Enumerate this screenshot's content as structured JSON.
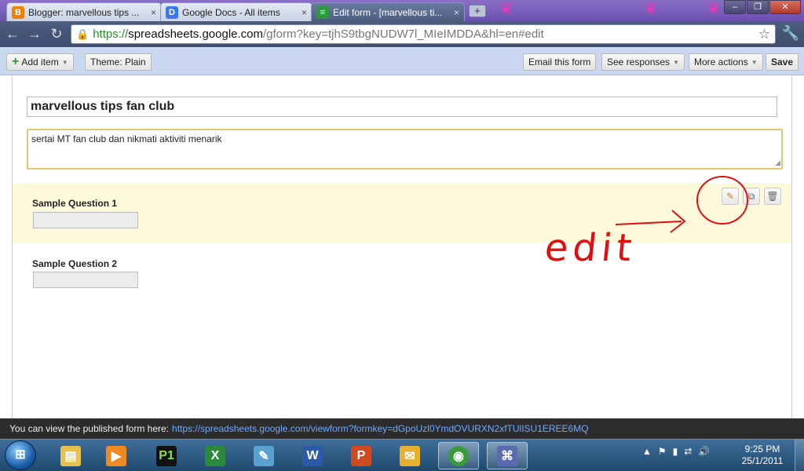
{
  "browser": {
    "tabs": [
      {
        "label": "Blogger: marvellous tips ...",
        "icon": "blogger-icon",
        "icon_char": "B",
        "icon_color": "#f57d00"
      },
      {
        "label": "Google Docs - All items",
        "icon": "google-docs-icon",
        "icon_char": "D",
        "icon_color": "#3b78e7"
      },
      {
        "label": "Edit form - [marvellous ti...",
        "icon": "form-icon",
        "icon_char": "≡",
        "icon_color": "#2e9a3e",
        "active": true
      }
    ],
    "tab_close": "×",
    "new_tab": "+",
    "window_buttons": {
      "minimize": "–",
      "restore": "❐",
      "close": "✕"
    },
    "address": {
      "scheme": "https://",
      "host": "spreadsheets.google.com",
      "path": "/gform?key=tjhS9tbgNUDW7l_MIeIMDDA&hl=en#edit"
    },
    "nav": {
      "back": "←",
      "forward": "→",
      "reload": "↻"
    },
    "star": "☆",
    "wrench": "🔧"
  },
  "formbar": {
    "add_item": "Add item",
    "theme": "Theme:  Plain",
    "email_form": "Email this form",
    "see_responses": "See responses",
    "more_actions": "More actions",
    "save": "Save"
  },
  "form": {
    "title": "marvellous tips fan club",
    "description": "sertai MT fan club dan nikmati aktiviti menarik",
    "questions": [
      {
        "title": "Sample Question 1"
      },
      {
        "title": "Sample Question 2"
      }
    ],
    "tools": {
      "edit": "✎",
      "duplicate": "⧉",
      "delete": "🗑"
    }
  },
  "annotation": {
    "text": "edit",
    "color": "#e01010"
  },
  "published": {
    "label": "You can view the published form here:",
    "url": "https://spreadsheets.google.com/viewform?formkey=dGpoUzl0YmdOVURXN2xfTUlISU1EREE6MQ"
  },
  "taskbar": {
    "start": "⊞",
    "apps": [
      {
        "name": "explorer-icon",
        "glyph": "▤",
        "color": "#e8c050"
      },
      {
        "name": "media-player-icon",
        "glyph": "▶",
        "color": "#f08a20"
      },
      {
        "name": "p1-icon",
        "glyph": "P1",
        "color": "#111111"
      },
      {
        "name": "excel-icon",
        "glyph": "X",
        "color": "#2a8a3a"
      },
      {
        "name": "notepad-icon",
        "glyph": "✎",
        "color": "#5aa0d0"
      },
      {
        "name": "word-icon",
        "glyph": "W",
        "color": "#2a5aa8"
      },
      {
        "name": "powerpoint-icon",
        "glyph": "P",
        "color": "#d04a20"
      },
      {
        "name": "outlook-icon",
        "glyph": "✉",
        "color": "#e8b030"
      },
      {
        "name": "chrome-icon",
        "glyph": "◉",
        "color": "#3a9a3a",
        "active": true
      },
      {
        "name": "network-app-icon",
        "glyph": "⌘",
        "color": "#5a6ab0",
        "active": true
      }
    ],
    "tray": [
      "▲",
      "⚑",
      "▮",
      "⇄",
      "🔊"
    ],
    "time": "9:25 PM",
    "date": "25/1/2011"
  }
}
